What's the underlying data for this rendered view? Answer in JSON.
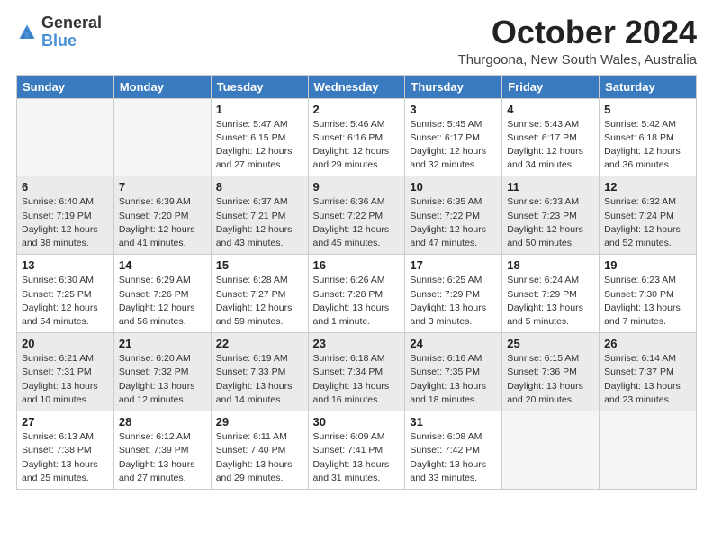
{
  "logo": {
    "general": "General",
    "blue": "Blue"
  },
  "header": {
    "month": "October 2024",
    "location": "Thurgoona, New South Wales, Australia"
  },
  "weekdays": [
    "Sunday",
    "Monday",
    "Tuesday",
    "Wednesday",
    "Thursday",
    "Friday",
    "Saturday"
  ],
  "weeks": [
    {
      "shaded": false,
      "days": [
        {
          "num": "",
          "info": ""
        },
        {
          "num": "",
          "info": ""
        },
        {
          "num": "1",
          "info": "Sunrise: 5:47 AM\nSunset: 6:15 PM\nDaylight: 12 hours\nand 27 minutes."
        },
        {
          "num": "2",
          "info": "Sunrise: 5:46 AM\nSunset: 6:16 PM\nDaylight: 12 hours\nand 29 minutes."
        },
        {
          "num": "3",
          "info": "Sunrise: 5:45 AM\nSunset: 6:17 PM\nDaylight: 12 hours\nand 32 minutes."
        },
        {
          "num": "4",
          "info": "Sunrise: 5:43 AM\nSunset: 6:17 PM\nDaylight: 12 hours\nand 34 minutes."
        },
        {
          "num": "5",
          "info": "Sunrise: 5:42 AM\nSunset: 6:18 PM\nDaylight: 12 hours\nand 36 minutes."
        }
      ]
    },
    {
      "shaded": true,
      "days": [
        {
          "num": "6",
          "info": "Sunrise: 6:40 AM\nSunset: 7:19 PM\nDaylight: 12 hours\nand 38 minutes."
        },
        {
          "num": "7",
          "info": "Sunrise: 6:39 AM\nSunset: 7:20 PM\nDaylight: 12 hours\nand 41 minutes."
        },
        {
          "num": "8",
          "info": "Sunrise: 6:37 AM\nSunset: 7:21 PM\nDaylight: 12 hours\nand 43 minutes."
        },
        {
          "num": "9",
          "info": "Sunrise: 6:36 AM\nSunset: 7:22 PM\nDaylight: 12 hours\nand 45 minutes."
        },
        {
          "num": "10",
          "info": "Sunrise: 6:35 AM\nSunset: 7:22 PM\nDaylight: 12 hours\nand 47 minutes."
        },
        {
          "num": "11",
          "info": "Sunrise: 6:33 AM\nSunset: 7:23 PM\nDaylight: 12 hours\nand 50 minutes."
        },
        {
          "num": "12",
          "info": "Sunrise: 6:32 AM\nSunset: 7:24 PM\nDaylight: 12 hours\nand 52 minutes."
        }
      ]
    },
    {
      "shaded": false,
      "days": [
        {
          "num": "13",
          "info": "Sunrise: 6:30 AM\nSunset: 7:25 PM\nDaylight: 12 hours\nand 54 minutes."
        },
        {
          "num": "14",
          "info": "Sunrise: 6:29 AM\nSunset: 7:26 PM\nDaylight: 12 hours\nand 56 minutes."
        },
        {
          "num": "15",
          "info": "Sunrise: 6:28 AM\nSunset: 7:27 PM\nDaylight: 12 hours\nand 59 minutes."
        },
        {
          "num": "16",
          "info": "Sunrise: 6:26 AM\nSunset: 7:28 PM\nDaylight: 13 hours\nand 1 minute."
        },
        {
          "num": "17",
          "info": "Sunrise: 6:25 AM\nSunset: 7:29 PM\nDaylight: 13 hours\nand 3 minutes."
        },
        {
          "num": "18",
          "info": "Sunrise: 6:24 AM\nSunset: 7:29 PM\nDaylight: 13 hours\nand 5 minutes."
        },
        {
          "num": "19",
          "info": "Sunrise: 6:23 AM\nSunset: 7:30 PM\nDaylight: 13 hours\nand 7 minutes."
        }
      ]
    },
    {
      "shaded": true,
      "days": [
        {
          "num": "20",
          "info": "Sunrise: 6:21 AM\nSunset: 7:31 PM\nDaylight: 13 hours\nand 10 minutes."
        },
        {
          "num": "21",
          "info": "Sunrise: 6:20 AM\nSunset: 7:32 PM\nDaylight: 13 hours\nand 12 minutes."
        },
        {
          "num": "22",
          "info": "Sunrise: 6:19 AM\nSunset: 7:33 PM\nDaylight: 13 hours\nand 14 minutes."
        },
        {
          "num": "23",
          "info": "Sunrise: 6:18 AM\nSunset: 7:34 PM\nDaylight: 13 hours\nand 16 minutes."
        },
        {
          "num": "24",
          "info": "Sunrise: 6:16 AM\nSunset: 7:35 PM\nDaylight: 13 hours\nand 18 minutes."
        },
        {
          "num": "25",
          "info": "Sunrise: 6:15 AM\nSunset: 7:36 PM\nDaylight: 13 hours\nand 20 minutes."
        },
        {
          "num": "26",
          "info": "Sunrise: 6:14 AM\nSunset: 7:37 PM\nDaylight: 13 hours\nand 23 minutes."
        }
      ]
    },
    {
      "shaded": false,
      "days": [
        {
          "num": "27",
          "info": "Sunrise: 6:13 AM\nSunset: 7:38 PM\nDaylight: 13 hours\nand 25 minutes."
        },
        {
          "num": "28",
          "info": "Sunrise: 6:12 AM\nSunset: 7:39 PM\nDaylight: 13 hours\nand 27 minutes."
        },
        {
          "num": "29",
          "info": "Sunrise: 6:11 AM\nSunset: 7:40 PM\nDaylight: 13 hours\nand 29 minutes."
        },
        {
          "num": "30",
          "info": "Sunrise: 6:09 AM\nSunset: 7:41 PM\nDaylight: 13 hours\nand 31 minutes."
        },
        {
          "num": "31",
          "info": "Sunrise: 6:08 AM\nSunset: 7:42 PM\nDaylight: 13 hours\nand 33 minutes."
        },
        {
          "num": "",
          "info": ""
        },
        {
          "num": "",
          "info": ""
        }
      ]
    }
  ]
}
